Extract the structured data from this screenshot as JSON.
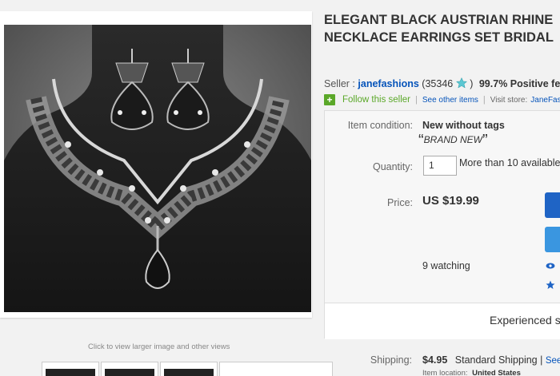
{
  "gallery": {
    "view_larger_text": "Click to view larger image and other views"
  },
  "item": {
    "title_line1": "ELEGANT BLACK AUSTRIAN RHINE",
    "title_line2": "NECKLACE EARRINGS SET BRIDAL"
  },
  "seller": {
    "label": "Seller :",
    "name": "janefashions",
    "score": "(35346",
    "positive": "99.7% Positive fe",
    "follow_label": "Follow this seller",
    "other_items_label": "See other items",
    "visit_store_label": "Visit store:",
    "store_name": "JaneFas"
  },
  "details": {
    "condition_label": "Item condition:",
    "condition_value": "New without tags",
    "condition_note": "BRAND NEW",
    "quantity_label": "Quantity:",
    "quantity_value": "1",
    "quantity_available": "More than 10 available",
    "price_label": "Price:",
    "price_value": "US $19.99",
    "watching": "9 watching",
    "experienced": "Experienced se"
  },
  "shipping": {
    "label": "Shipping:",
    "cost": "$4.95",
    "method": "Standard Shipping",
    "see_link": "See",
    "location_label": "Item location:",
    "location_value": "United States"
  }
}
